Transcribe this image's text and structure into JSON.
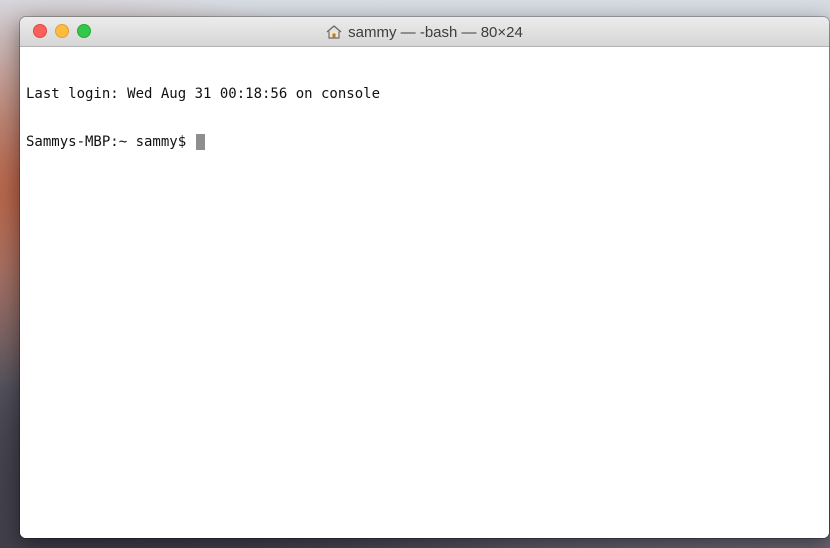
{
  "window": {
    "title": "sammy — -bash — 80×24",
    "title_icon": "home-icon"
  },
  "traffic_lights": {
    "close_color": "#fc605c",
    "minimize_color": "#fdbc40",
    "zoom_color": "#34c84a"
  },
  "terminal": {
    "last_login": "Last login: Wed Aug 31 00:18:56 on console",
    "prompt": "Sammys-MBP:~ sammy$ ",
    "cursor": "block-cursor"
  }
}
